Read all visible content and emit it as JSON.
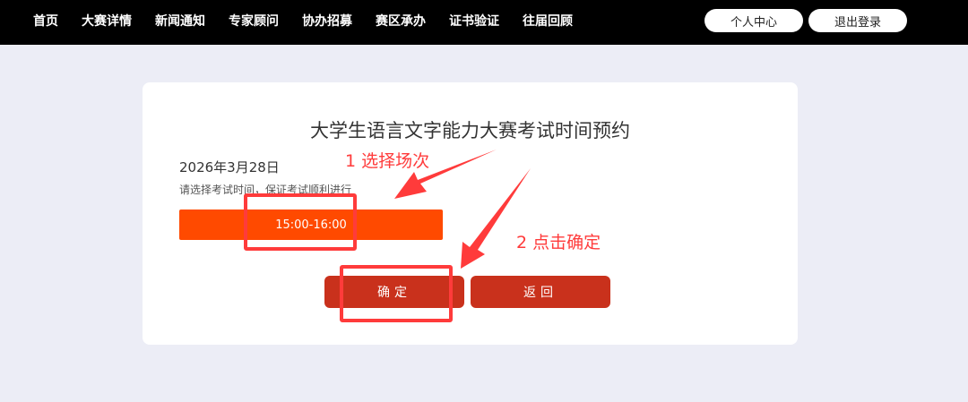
{
  "nav": {
    "items": [
      "首页",
      "大赛详情",
      "新闻通知",
      "专家顾问",
      "协办招募",
      "赛区承办",
      "证书验证",
      "往届回顾"
    ],
    "profile_label": "个人中心",
    "logout_label": "退出登录"
  },
  "card": {
    "title": "大学生语言文字能力大赛考试时间预约",
    "date": "2026年3月28日",
    "hint": "请选择考试时间，保证考试顺利进行",
    "slot_label": "15:00-16:00",
    "confirm_label": "确定",
    "back_label": "返回"
  },
  "annotations": {
    "step1": "1 选择场次",
    "step2": "2 点击确定"
  },
  "colors": {
    "topbar": "#000000",
    "page_bg": "#ecedf6",
    "slot": "#ff4a00",
    "button": "#c9311c",
    "annotation": "#ff3b3b"
  }
}
